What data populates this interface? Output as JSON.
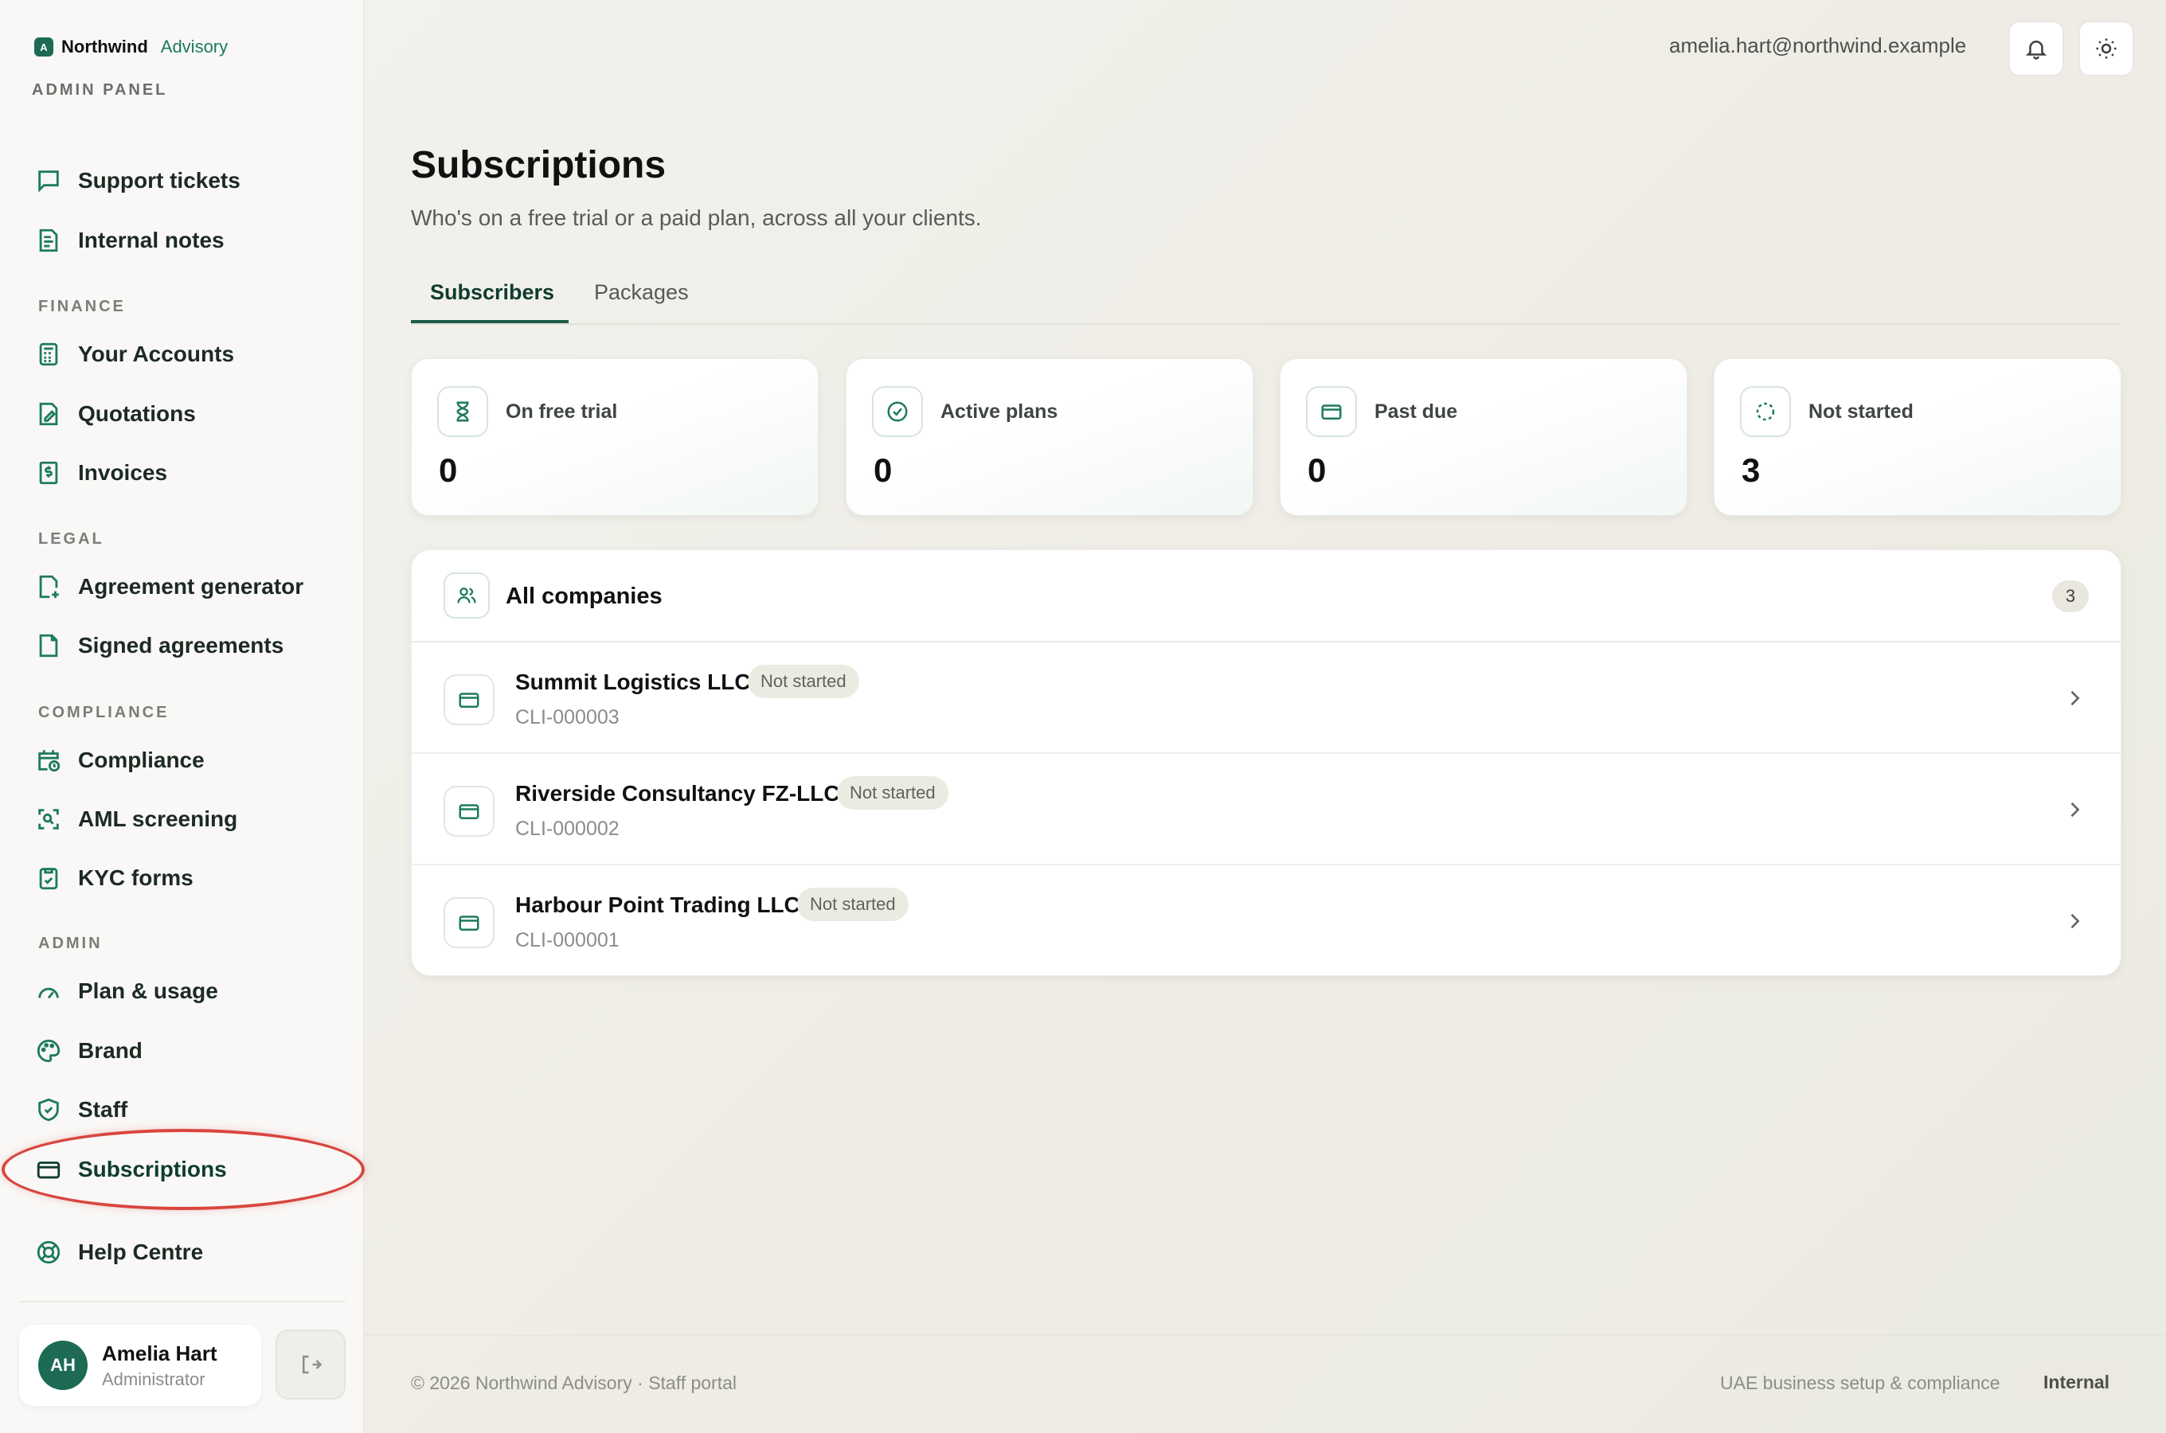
{
  "brand": {
    "logo_letter": "A",
    "name": "Northwind",
    "sub": "Advisory",
    "panel_label": "ADMIN PANEL"
  },
  "sidebar": {
    "top_items": [
      {
        "label": "Support tickets",
        "icon": "chat-icon"
      },
      {
        "label": "Internal notes",
        "icon": "notes-icon"
      }
    ],
    "sections": [
      {
        "title": "FINANCE",
        "items": [
          {
            "label": "Your Accounts",
            "icon": "calculator-icon"
          },
          {
            "label": "Quotations",
            "icon": "quote-doc-icon"
          },
          {
            "label": "Invoices",
            "icon": "invoice-icon"
          }
        ]
      },
      {
        "title": "LEGAL",
        "items": [
          {
            "label": "Agreement generator",
            "icon": "doc-plus-icon"
          },
          {
            "label": "Signed agreements",
            "icon": "doc-icon"
          }
        ]
      },
      {
        "title": "COMPLIANCE",
        "items": [
          {
            "label": "Compliance",
            "icon": "calendar-clock-icon"
          },
          {
            "label": "AML screening",
            "icon": "scan-icon"
          },
          {
            "label": "KYC forms",
            "icon": "clipboard-icon"
          }
        ]
      },
      {
        "title": "ADMIN",
        "items": [
          {
            "label": "Plan & usage",
            "icon": "gauge-icon"
          },
          {
            "label": "Brand",
            "icon": "palette-icon"
          },
          {
            "label": "Staff",
            "icon": "shield-icon"
          },
          {
            "label": "Subscriptions",
            "icon": "card-icon",
            "active": true
          }
        ]
      }
    ],
    "help": {
      "label": "Help Centre",
      "icon": "lifebuoy-icon"
    },
    "user": {
      "initials": "AH",
      "name": "Amelia Hart",
      "role": "Administrator"
    }
  },
  "header": {
    "email": "amelia.hart@northwind.example"
  },
  "page": {
    "title": "Subscriptions",
    "subtitle": "Who's on a free trial or a paid plan, across all your clients.",
    "tabs": [
      {
        "label": "Subscribers",
        "active": true
      },
      {
        "label": "Packages",
        "active": false
      }
    ]
  },
  "stats": [
    {
      "label": "On free trial",
      "value": "0",
      "icon": "hourglass-icon"
    },
    {
      "label": "Active plans",
      "value": "0",
      "icon": "check-circle-icon"
    },
    {
      "label": "Past due",
      "value": "0",
      "icon": "card-icon"
    },
    {
      "label": "Not started",
      "value": "3",
      "icon": "dashed-circle-icon"
    }
  ],
  "companies": {
    "title": "All companies",
    "count": "3",
    "rows": [
      {
        "name": "Summit Logistics LLC",
        "status": "Not started",
        "id": "CLI-000003"
      },
      {
        "name": "Riverside Consultancy FZ-LLC",
        "status": "Not started",
        "id": "CLI-000002"
      },
      {
        "name": "Harbour Point Trading LLC",
        "status": "Not started",
        "id": "CLI-000001"
      }
    ]
  },
  "footer": {
    "left": "© 2026 Northwind Advisory · Staff portal",
    "right": "UAE business setup & compliance",
    "badge": "Internal"
  },
  "colors": {
    "accent": "#1d7a5e",
    "accent_dark": "#0f3c2f",
    "highlight": "#d8463f"
  }
}
